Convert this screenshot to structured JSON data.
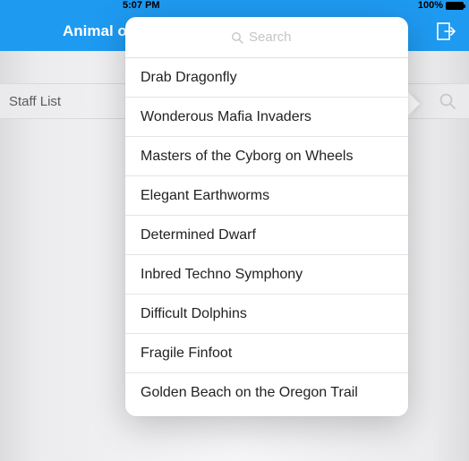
{
  "status": {
    "time": "5:07 PM",
    "battery_pct": "100%"
  },
  "nav": {
    "title": "Animal or"
  },
  "section": {
    "label": "Staff List"
  },
  "popover": {
    "search_placeholder": "Search",
    "items": [
      "Drab Dragonfly",
      "Wonderous Mafia Invaders",
      "Masters of the Cyborg on Wheels",
      "Elegant Earthworms",
      "Determined Dwarf",
      "Inbred Techno Symphony",
      "Difficult Dolphins",
      "Fragile Finfoot",
      "Golden Beach on the Oregon Trail"
    ]
  }
}
